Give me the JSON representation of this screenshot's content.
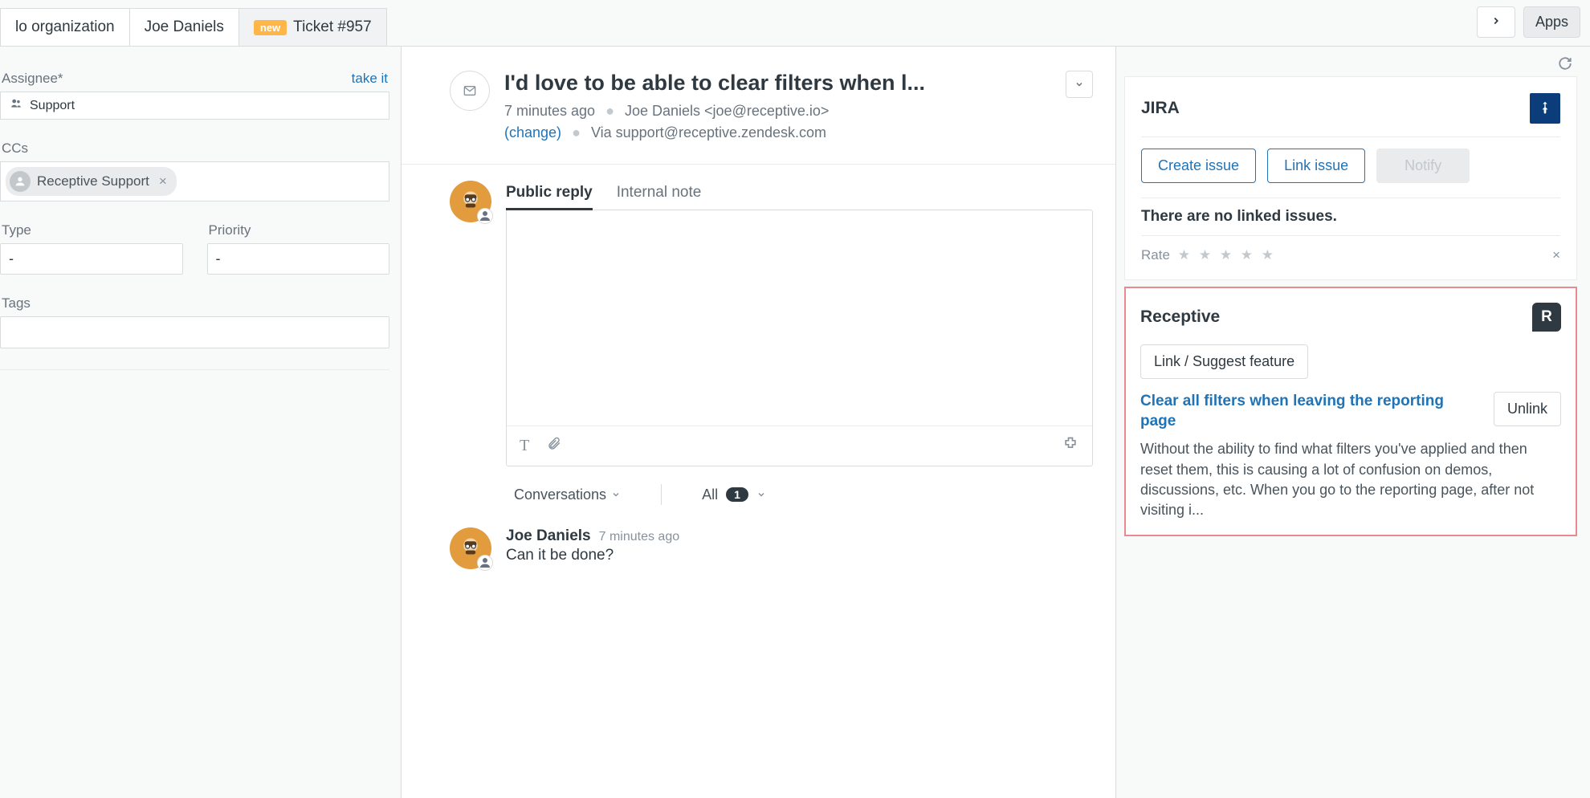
{
  "tabs": {
    "org": "lo organization",
    "user": "Joe Daniels",
    "badge": "new",
    "ticket": "Ticket #957",
    "apps": "Apps"
  },
  "left": {
    "assignee_label": "Assignee*",
    "take_it": "take it",
    "assignee_value": "Support",
    "ccs_label": "CCs",
    "cc_chip": "Receptive Support",
    "type_label": "Type",
    "type_value": "-",
    "priority_label": "Priority",
    "priority_value": "-",
    "tags_label": "Tags"
  },
  "ticket": {
    "title": "I'd love to be able to clear filters when l...",
    "time": "7 minutes ago",
    "requester": "Joe Daniels <joe@receptive.io>",
    "change": "(change)",
    "via": "Via support@receptive.zendesk.com"
  },
  "compose": {
    "tab_public": "Public reply",
    "tab_internal": "Internal note"
  },
  "filter": {
    "conversations": "Conversations",
    "all": "All",
    "count": "1"
  },
  "msg": {
    "author": "Joe Daniels",
    "time": "7 minutes ago",
    "body": "Can it be done?"
  },
  "jira": {
    "title": "JIRA",
    "create": "Create issue",
    "link": "Link issue",
    "notify": "Notify",
    "none": "There are no linked issues.",
    "rate": "Rate"
  },
  "receptive": {
    "title": "Receptive",
    "link_btn": "Link / Suggest feature",
    "feature": "Clear all filters when leaving the reporting page",
    "unlink": "Unlink",
    "desc": "Without the ability to find what filters you've applied and then reset them, this is causing a lot of confusion on demos, discussions, etc. When you go to the reporting page, after not visiting i..."
  }
}
